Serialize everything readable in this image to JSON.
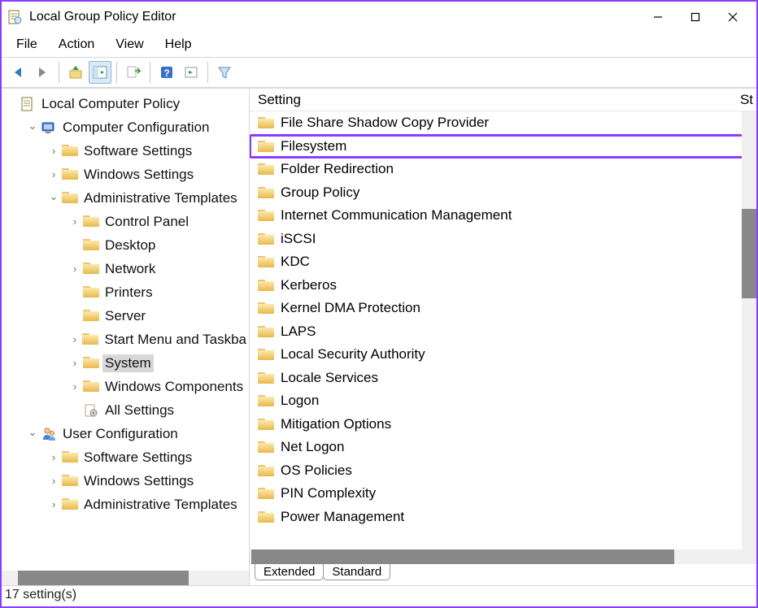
{
  "title": "Local Group Policy Editor",
  "menu": [
    "File",
    "Action",
    "View",
    "Help"
  ],
  "tree": [
    {
      "depth": 0,
      "tw": "",
      "icon": "doc",
      "label": "Local Computer Policy"
    },
    {
      "depth": 1,
      "tw": "v",
      "icon": "comp",
      "label": "Computer Configuration"
    },
    {
      "depth": 2,
      "tw": ">",
      "icon": "folder",
      "label": "Software Settings"
    },
    {
      "depth": 2,
      "tw": ">",
      "icon": "folder",
      "label": "Windows Settings"
    },
    {
      "depth": 2,
      "tw": "v",
      "icon": "folder",
      "label": "Administrative Templates"
    },
    {
      "depth": 3,
      "tw": ">",
      "icon": "folder",
      "label": "Control Panel"
    },
    {
      "depth": 3,
      "tw": "",
      "icon": "folder",
      "label": "Desktop"
    },
    {
      "depth": 3,
      "tw": ">",
      "icon": "folder",
      "label": "Network"
    },
    {
      "depth": 3,
      "tw": "",
      "icon": "folder",
      "label": "Printers"
    },
    {
      "depth": 3,
      "tw": "",
      "icon": "folder",
      "label": "Server"
    },
    {
      "depth": 3,
      "tw": ">",
      "icon": "folder",
      "label": "Start Menu and Taskba"
    },
    {
      "depth": 3,
      "tw": ">",
      "icon": "folder",
      "label": "System",
      "selected": true
    },
    {
      "depth": 3,
      "tw": ">",
      "icon": "folder",
      "label": "Windows Components"
    },
    {
      "depth": 3,
      "tw": "",
      "icon": "gear",
      "label": "All Settings"
    },
    {
      "depth": 1,
      "tw": "v",
      "icon": "user",
      "label": "User Configuration"
    },
    {
      "depth": 2,
      "tw": ">",
      "icon": "folder",
      "label": "Software Settings"
    },
    {
      "depth": 2,
      "tw": ">",
      "icon": "folder",
      "label": "Windows Settings"
    },
    {
      "depth": 2,
      "tw": ">",
      "icon": "folder",
      "label": "Administrative Templates"
    }
  ],
  "list_header": {
    "col1": "Setting",
    "col2": "St"
  },
  "list": [
    {
      "label": "File Share Shadow Copy Provider"
    },
    {
      "label": "Filesystem",
      "hl": true
    },
    {
      "label": "Folder Redirection"
    },
    {
      "label": "Group Policy"
    },
    {
      "label": "Internet Communication Management"
    },
    {
      "label": "iSCSI"
    },
    {
      "label": "KDC"
    },
    {
      "label": "Kerberos"
    },
    {
      "label": "Kernel DMA Protection"
    },
    {
      "label": "LAPS"
    },
    {
      "label": "Local Security Authority"
    },
    {
      "label": "Locale Services"
    },
    {
      "label": "Logon"
    },
    {
      "label": "Mitigation Options"
    },
    {
      "label": "Net Logon"
    },
    {
      "label": "OS Policies"
    },
    {
      "label": "PIN Complexity"
    },
    {
      "label": "Power Management"
    }
  ],
  "tabs": [
    "Extended",
    "Standard"
  ],
  "active_tab": 1,
  "status": "17 setting(s)"
}
